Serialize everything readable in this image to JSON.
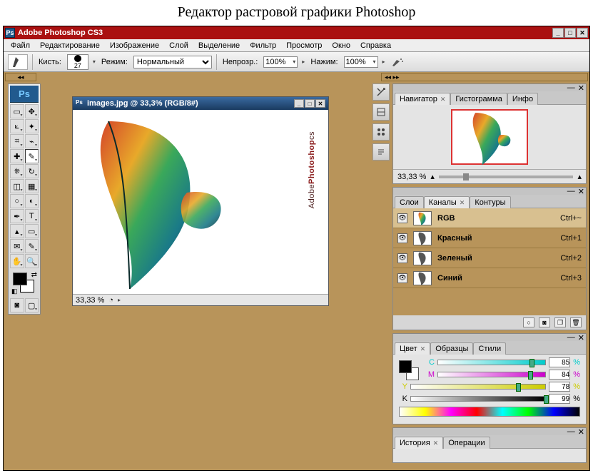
{
  "page": {
    "heading": "Редактор растровой графики Photoshop"
  },
  "titlebar": {
    "app_icon_text": "Ps",
    "title": "Adobe Photoshop CS3"
  },
  "menubar": {
    "items": [
      "Файл",
      "Редактирование",
      "Изображение",
      "Слой",
      "Выделение",
      "Фильтр",
      "Просмотр",
      "Окно",
      "Справка"
    ]
  },
  "options_bar": {
    "brush_label": "Кисть:",
    "brush_size": "27",
    "mode_label": "Режим:",
    "mode_value": "Нормальный",
    "opacity_label": "Непрозр.:",
    "opacity_value": "100%",
    "flow_label": "Нажим:",
    "flow_value": "100%"
  },
  "toolbox": {
    "logo": "Ps",
    "tools": [
      [
        "marquee",
        "▭"
      ],
      [
        "move",
        "✥"
      ],
      [
        "lasso",
        "⟀"
      ],
      [
        "wand",
        "✦"
      ],
      [
        "crop",
        "⌗"
      ],
      [
        "slice",
        "⌁"
      ],
      [
        "heal",
        "✚"
      ],
      [
        "brush",
        "✎"
      ],
      [
        "stamp",
        "⎈"
      ],
      [
        "history-brush",
        "↻"
      ],
      [
        "eraser",
        "◫"
      ],
      [
        "gradient",
        "▦"
      ],
      [
        "blur",
        "○"
      ],
      [
        "dodge",
        "◐"
      ],
      [
        "pen",
        "✒"
      ],
      [
        "type",
        "T"
      ],
      [
        "path-select",
        "▴"
      ],
      [
        "shape",
        "▭"
      ],
      [
        "notes",
        "✉"
      ],
      [
        "eyedropper",
        "✎"
      ],
      [
        "hand",
        "✋"
      ],
      [
        "zoom",
        "🔍"
      ]
    ]
  },
  "document": {
    "title": "images.jpg @ 33,3% (RGB/8#)",
    "status_zoom": "33,33 %",
    "sidebar_text_brand": "Adobe",
    "sidebar_text_product": "Photoshop",
    "sidebar_text_suffix": "cs"
  },
  "navigator": {
    "tabs": [
      "Навигатор",
      "Гистограмма",
      "Инфо"
    ],
    "active_tab": 0,
    "zoom": "33,33 %"
  },
  "channels": {
    "tabs": [
      "Слои",
      "Каналы",
      "Контуры"
    ],
    "active_tab": 1,
    "rows": [
      {
        "name": "RGB",
        "shortcut": "Ctrl+~",
        "selected": true
      },
      {
        "name": "Красный",
        "shortcut": "Ctrl+1",
        "selected": false
      },
      {
        "name": "Зеленый",
        "shortcut": "Ctrl+2",
        "selected": false
      },
      {
        "name": "Синий",
        "shortcut": "Ctrl+3",
        "selected": false
      }
    ]
  },
  "color": {
    "tabs": [
      "Цвет",
      "Образцы",
      "Стили"
    ],
    "active_tab": 0,
    "channels": [
      {
        "label": "C",
        "value": "85",
        "pct": "%"
      },
      {
        "label": "M",
        "value": "84",
        "pct": "%"
      },
      {
        "label": "Y",
        "value": "78",
        "pct": "%"
      },
      {
        "label": "K",
        "value": "99",
        "pct": "%"
      }
    ]
  },
  "history": {
    "tabs": [
      "История",
      "Операции"
    ],
    "active_tab": 0
  },
  "icon_strip": {
    "icons": [
      "tools-icon",
      "brushes-icon",
      "styles-icon",
      "paragraph-icon"
    ]
  }
}
